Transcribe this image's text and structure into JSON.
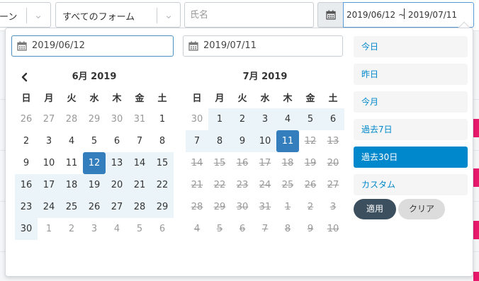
{
  "filters": {
    "first_select": "ーン",
    "form_select": "すべてのフォーム",
    "name_placeholder": "氏名",
    "date_range_value": "2019/06/12 ~ 2019/07/11"
  },
  "picker": {
    "start_date": "2019/06/12",
    "end_date": "2019/07/11",
    "weekdays": [
      "日",
      "月",
      "火",
      "水",
      "木",
      "金",
      "土"
    ],
    "left_month": {
      "title": "6月 2019",
      "days": [
        {
          "d": "26",
          "s": "off"
        },
        {
          "d": "27",
          "s": "off"
        },
        {
          "d": "28",
          "s": "off"
        },
        {
          "d": "29",
          "s": "off"
        },
        {
          "d": "30",
          "s": "off"
        },
        {
          "d": "31",
          "s": "off"
        },
        {
          "d": "1",
          "s": ""
        },
        {
          "d": "2",
          "s": ""
        },
        {
          "d": "3",
          "s": ""
        },
        {
          "d": "4",
          "s": ""
        },
        {
          "d": "5",
          "s": ""
        },
        {
          "d": "6",
          "s": ""
        },
        {
          "d": "7",
          "s": ""
        },
        {
          "d": "8",
          "s": ""
        },
        {
          "d": "9",
          "s": ""
        },
        {
          "d": "10",
          "s": ""
        },
        {
          "d": "11",
          "s": ""
        },
        {
          "d": "12",
          "s": "sel"
        },
        {
          "d": "13",
          "s": "in"
        },
        {
          "d": "14",
          "s": "in"
        },
        {
          "d": "15",
          "s": "in"
        },
        {
          "d": "16",
          "s": "in"
        },
        {
          "d": "17",
          "s": "in"
        },
        {
          "d": "18",
          "s": "in"
        },
        {
          "d": "19",
          "s": "in"
        },
        {
          "d": "20",
          "s": "in"
        },
        {
          "d": "21",
          "s": "in"
        },
        {
          "d": "22",
          "s": "in"
        },
        {
          "d": "23",
          "s": "in"
        },
        {
          "d": "24",
          "s": "in"
        },
        {
          "d": "25",
          "s": "in"
        },
        {
          "d": "26",
          "s": "in"
        },
        {
          "d": "27",
          "s": "in"
        },
        {
          "d": "28",
          "s": "in"
        },
        {
          "d": "29",
          "s": "in"
        },
        {
          "d": "30",
          "s": "in"
        },
        {
          "d": "1",
          "s": "off"
        },
        {
          "d": "2",
          "s": "off"
        },
        {
          "d": "3",
          "s": "off"
        },
        {
          "d": "4",
          "s": "off"
        },
        {
          "d": "5",
          "s": "off"
        },
        {
          "d": "6",
          "s": "off"
        }
      ]
    },
    "right_month": {
      "title": "7月 2019",
      "days": [
        {
          "d": "30",
          "s": "off"
        },
        {
          "d": "1",
          "s": "in"
        },
        {
          "d": "2",
          "s": "in"
        },
        {
          "d": "3",
          "s": "in"
        },
        {
          "d": "4",
          "s": "in"
        },
        {
          "d": "5",
          "s": "in"
        },
        {
          "d": "6",
          "s": "in"
        },
        {
          "d": "7",
          "s": "in"
        },
        {
          "d": "8",
          "s": "in"
        },
        {
          "d": "9",
          "s": "in"
        },
        {
          "d": "10",
          "s": "in"
        },
        {
          "d": "11",
          "s": "sel"
        },
        {
          "d": "12",
          "s": "dis"
        },
        {
          "d": "13",
          "s": "dis"
        },
        {
          "d": "14",
          "s": "dis"
        },
        {
          "d": "15",
          "s": "dis"
        },
        {
          "d": "16",
          "s": "dis"
        },
        {
          "d": "17",
          "s": "dis"
        },
        {
          "d": "18",
          "s": "dis"
        },
        {
          "d": "19",
          "s": "dis"
        },
        {
          "d": "20",
          "s": "dis"
        },
        {
          "d": "21",
          "s": "dis"
        },
        {
          "d": "22",
          "s": "dis"
        },
        {
          "d": "23",
          "s": "dis"
        },
        {
          "d": "24",
          "s": "dis"
        },
        {
          "d": "25",
          "s": "dis"
        },
        {
          "d": "26",
          "s": "dis"
        },
        {
          "d": "27",
          "s": "dis"
        },
        {
          "d": "28",
          "s": "dis"
        },
        {
          "d": "29",
          "s": "dis"
        },
        {
          "d": "30",
          "s": "dis"
        },
        {
          "d": "31",
          "s": "dis"
        },
        {
          "d": "1",
          "s": "dis"
        },
        {
          "d": "2",
          "s": "dis"
        },
        {
          "d": "3",
          "s": "dis"
        },
        {
          "d": "4",
          "s": "dis"
        },
        {
          "d": "5",
          "s": "dis"
        },
        {
          "d": "6",
          "s": "dis"
        },
        {
          "d": "7",
          "s": "dis"
        },
        {
          "d": "8",
          "s": "dis"
        },
        {
          "d": "9",
          "s": "dis"
        },
        {
          "d": "10",
          "s": "dis"
        }
      ]
    },
    "ranges": [
      {
        "label": "今日",
        "active": false
      },
      {
        "label": "昨日",
        "active": false
      },
      {
        "label": "今月",
        "active": false
      },
      {
        "label": "過去7日",
        "active": false
      },
      {
        "label": "過去30日",
        "active": true
      },
      {
        "label": "カスタム",
        "active": false
      }
    ],
    "apply_label": "適用",
    "clear_label": "クリア"
  },
  "colors": {
    "selected": "#357ebd",
    "in_range": "#ebf4f8",
    "range_link": "#0088cc",
    "apply_bg": "#3c4f5e",
    "accent_strip": "#e8196b"
  }
}
